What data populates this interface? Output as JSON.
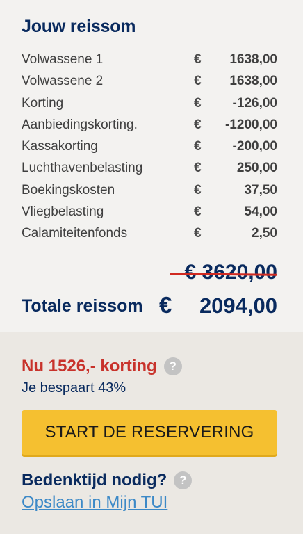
{
  "trip_summary": {
    "title": "Jouw reissom",
    "currency_symbol": "€",
    "rows": [
      {
        "label": "Volwassene 1",
        "amount": "1638,00"
      },
      {
        "label": "Volwassene 2",
        "amount": "1638,00"
      },
      {
        "label": "Korting",
        "amount": "-126,00"
      },
      {
        "label": "Aanbiedingskorting.",
        "amount": "-1200,00"
      },
      {
        "label": "Kassakorting",
        "amount": "-200,00"
      },
      {
        "label": "Luchthavenbelasting",
        "amount": "250,00"
      },
      {
        "label": "Boekingskosten",
        "amount": "37,50"
      },
      {
        "label": "Vliegbelasting",
        "amount": "54,00"
      },
      {
        "label": "Calamiteitenfonds",
        "amount": "2,50"
      }
    ],
    "old_price": "€ 3620,00",
    "total_label": "Totale reissom",
    "total_currency": "€",
    "total_amount": "2094,00"
  },
  "offer": {
    "discount_text": "Nu 1526,- korting",
    "savings_text": "Je bespaart 43%",
    "help_glyph": "?"
  },
  "actions": {
    "reserve_label": "START DE RESERVERING",
    "think_text": "Bedenktijd nodig?",
    "help_glyph": "?",
    "save_link": "Opslaan in Mijn TUI"
  },
  "colors": {
    "navy": "#092a5e",
    "discount_red": "#c8322b",
    "button_yellow": "#f5c030",
    "link_blue": "#3c89c7"
  }
}
